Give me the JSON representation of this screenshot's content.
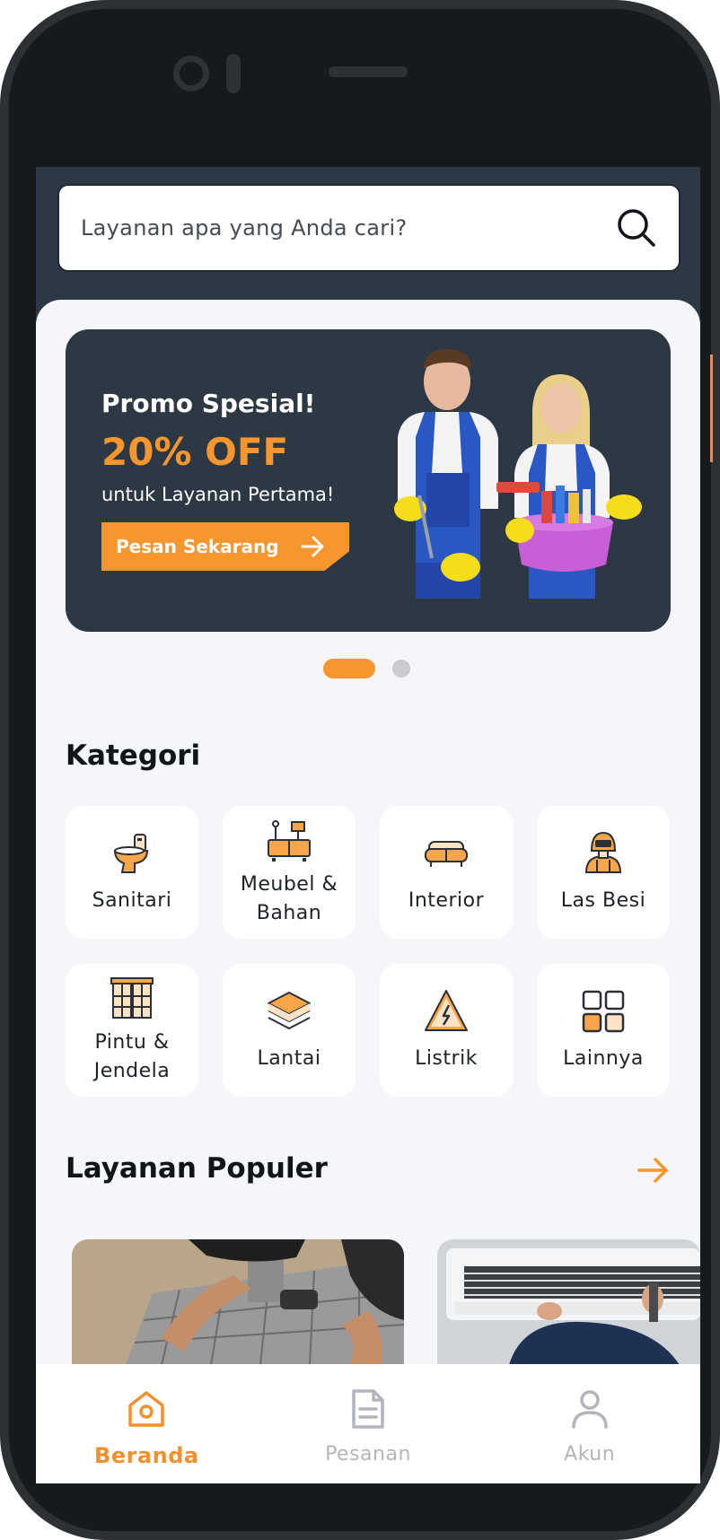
{
  "search": {
    "placeholder": "Layanan apa yang Anda cari?"
  },
  "banner": {
    "title": "Promo Spesial!",
    "discount": "20% OFF",
    "subtitle": "untuk Layanan Pertama!",
    "cta_label": "Pesan Sekarang"
  },
  "carousel": {
    "total_slides": 2,
    "active_slide": 1
  },
  "kategori": {
    "title": "Kategori",
    "items": [
      {
        "label": "Sanitari",
        "icon": "toilet-icon"
      },
      {
        "label": "Meubel &\nBahan",
        "icon": "furniture-icon"
      },
      {
        "label": "Interior",
        "icon": "sofa-icon"
      },
      {
        "label": "Las Besi",
        "icon": "welder-icon"
      },
      {
        "label": "Pintu &\nJendela",
        "icon": "window-icon"
      },
      {
        "label": "Lantai",
        "icon": "floor-layers-icon"
      },
      {
        "label": "Listrik",
        "icon": "electric-warning-icon"
      },
      {
        "label": "Lainnya",
        "icon": "grid-icon"
      }
    ]
  },
  "populer": {
    "title": "Layanan Populer",
    "cards": [
      {
        "image": "paving-tiles-photo"
      },
      {
        "image": "ac-service-photo"
      }
    ]
  },
  "nav": {
    "items": [
      {
        "label": "Beranda",
        "icon": "home-icon",
        "active": true
      },
      {
        "label": "Pesanan",
        "icon": "document-icon",
        "active": false
      },
      {
        "label": "Akun",
        "icon": "user-icon",
        "active": false
      }
    ]
  },
  "colors": {
    "accent": "#f7962e",
    "header_bg": "#2d3845",
    "content_bg": "#f4f6fa",
    "inactive": "#b2b6bb"
  }
}
